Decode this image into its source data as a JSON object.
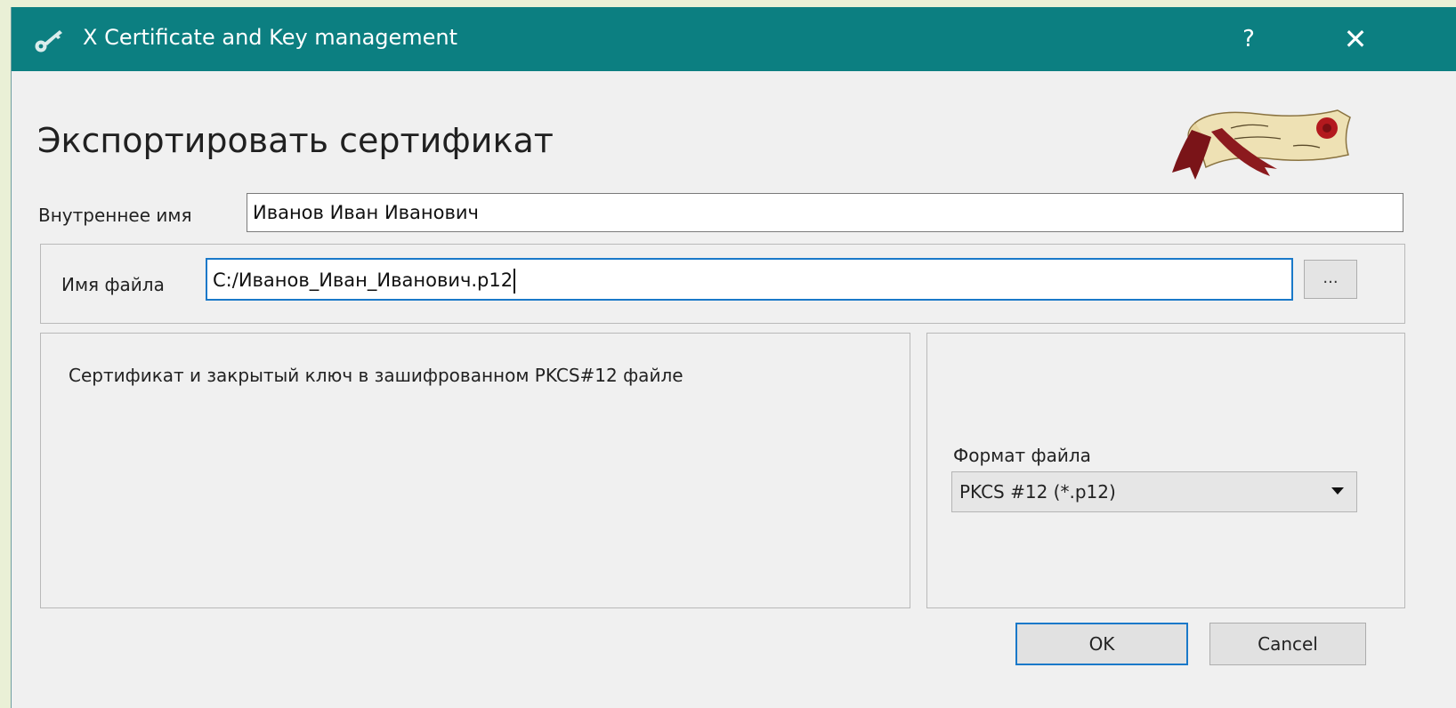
{
  "window": {
    "title": "X Certificate and Key management",
    "help_label": "?",
    "close_label": "✕",
    "app_icon": "key-icon",
    "colors": {
      "titlebar": "#0c7f81",
      "focus": "#1a79c9",
      "background": "#f0f0f0"
    }
  },
  "dialog": {
    "heading": "Экспортировать сертификат",
    "logo_icon": "certificate-scroll-logo",
    "internal_name": {
      "label": "Внутреннее имя",
      "value": "Иванов Иван Иванович"
    },
    "file_name": {
      "label": "Имя файла",
      "value": "C:/Иванов_Иван_Иванович.p12",
      "browse_label": "..."
    },
    "description": "Сертификат и закрытый ключ в зашифрованном PKCS#12 файле",
    "file_format": {
      "label": "Формат файла",
      "selected": "PKCS #12 (*.p12)"
    },
    "buttons": {
      "ok": "OK",
      "cancel": "Cancel"
    }
  }
}
